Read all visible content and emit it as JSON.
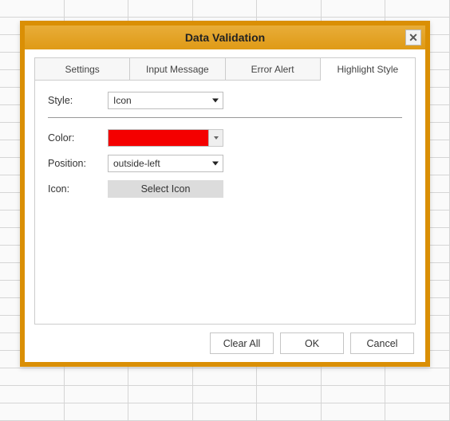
{
  "dialog": {
    "title": "Data Validation",
    "tabs": [
      {
        "label": "Settings"
      },
      {
        "label": "Input Message"
      },
      {
        "label": "Error Alert"
      },
      {
        "label": "Highlight Style"
      }
    ],
    "active_tab": 3,
    "style": {
      "label": "Style:",
      "value": "Icon"
    },
    "color": {
      "label": "Color:",
      "value_hex": "#f40000"
    },
    "position": {
      "label": "Position:",
      "value": "outside-left"
    },
    "icon": {
      "label": "Icon:",
      "button_label": "Select Icon"
    },
    "buttons": {
      "clear": "Clear All",
      "ok": "OK",
      "cancel": "Cancel"
    }
  }
}
